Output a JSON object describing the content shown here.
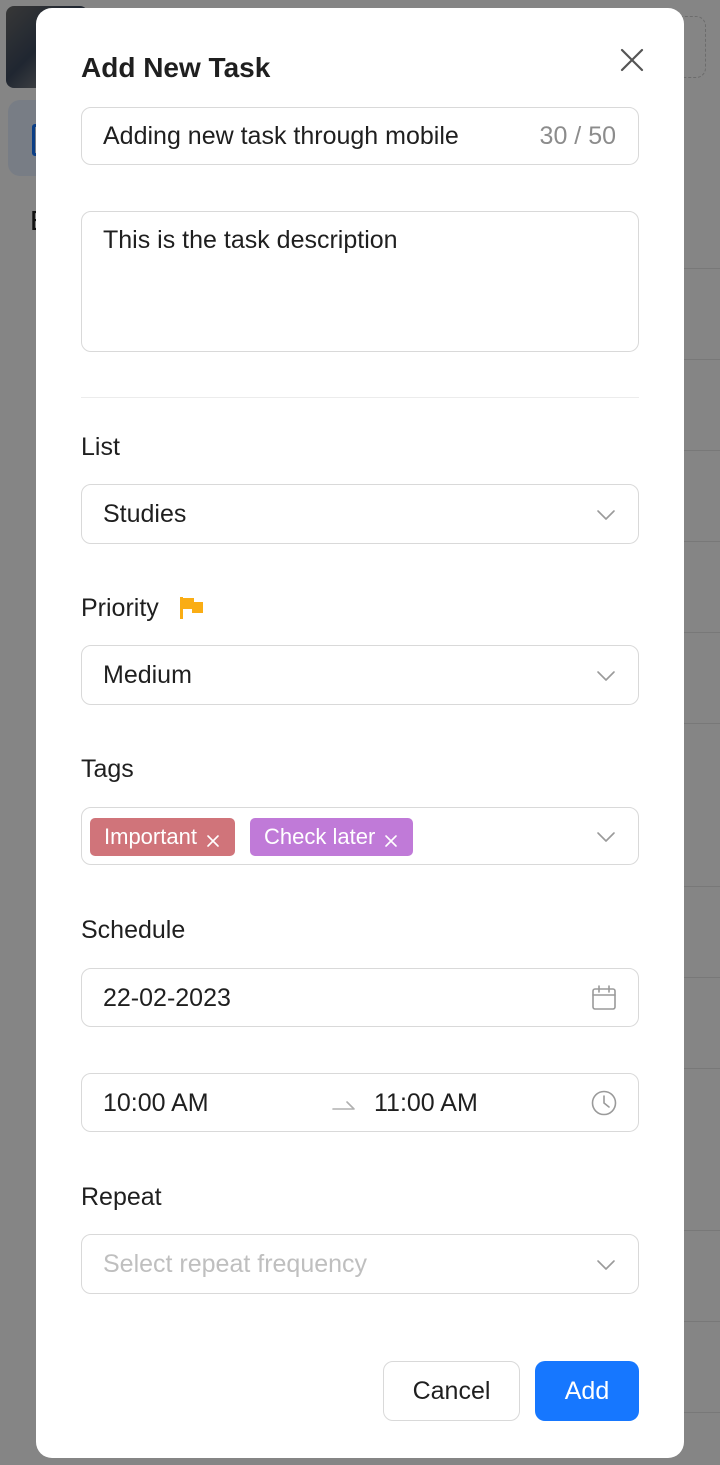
{
  "modal": {
    "title": "Add New Task"
  },
  "task": {
    "title_value": "Adding new task through mobile",
    "title_counter": "30 / 50",
    "description_value": "This is the task description"
  },
  "list": {
    "label": "List",
    "selected": "Studies"
  },
  "priority": {
    "label": "Priority",
    "selected": "Medium",
    "flag_color": "#faad14"
  },
  "tags": {
    "label": "Tags",
    "items": [
      {
        "label": "Important",
        "color": "#d0747a"
      },
      {
        "label": "Check later",
        "color": "#c07ad8"
      }
    ]
  },
  "schedule": {
    "label": "Schedule",
    "date": "22-02-2023",
    "start_time": "10:00 AM",
    "end_time": "11:00 AM"
  },
  "repeat": {
    "label": "Repeat",
    "placeholder": "Select repeat frequency"
  },
  "actions": {
    "cancel_label": "Cancel",
    "add_label": "Add",
    "primary_color": "#1677ff"
  }
}
